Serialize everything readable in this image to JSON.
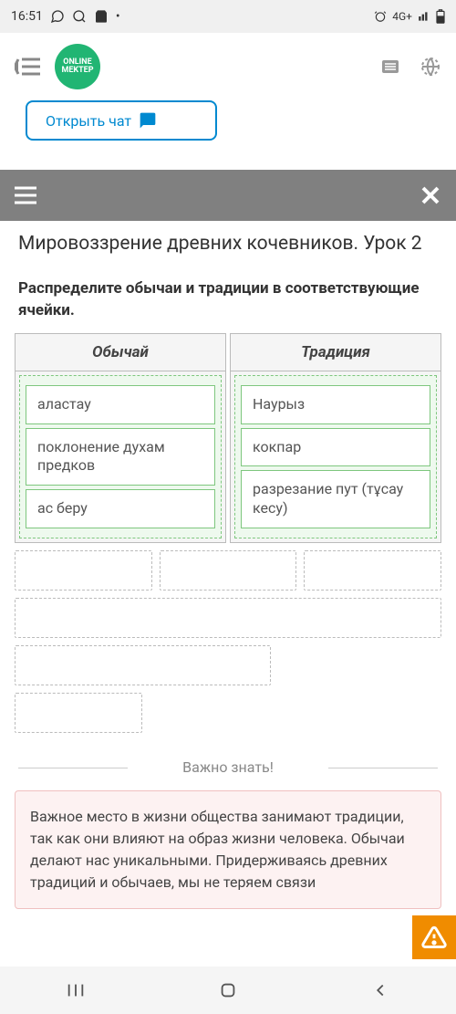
{
  "status": {
    "time": "16:51",
    "network": "4G+"
  },
  "header": {
    "logo_line1": "ONLINE",
    "logo_line2": "MEKTEP"
  },
  "chat": {
    "label": "Открыть чат"
  },
  "title": "Мировоззрение древних кочевников. Урок 2",
  "instruction": "Распределите обычаи и традиции в соответствующие ячейки.",
  "columns": {
    "custom": {
      "header": "Обычай",
      "items": [
        "аластау",
        "поклонение духам предков",
        "ас беру"
      ]
    },
    "tradition": {
      "header": "Традиция",
      "items": [
        "Наурыз",
        "кокпар",
        "разрезание пут (тұсау кесу)"
      ]
    }
  },
  "divider": "Важно знать!",
  "info": "Важное место в жизни общества занимают традиции, так как они влияют на образ жизни человека. Обычаи делают нас уникальными. Придерживаясь древних традиций и обычаев, мы не теряем связи"
}
